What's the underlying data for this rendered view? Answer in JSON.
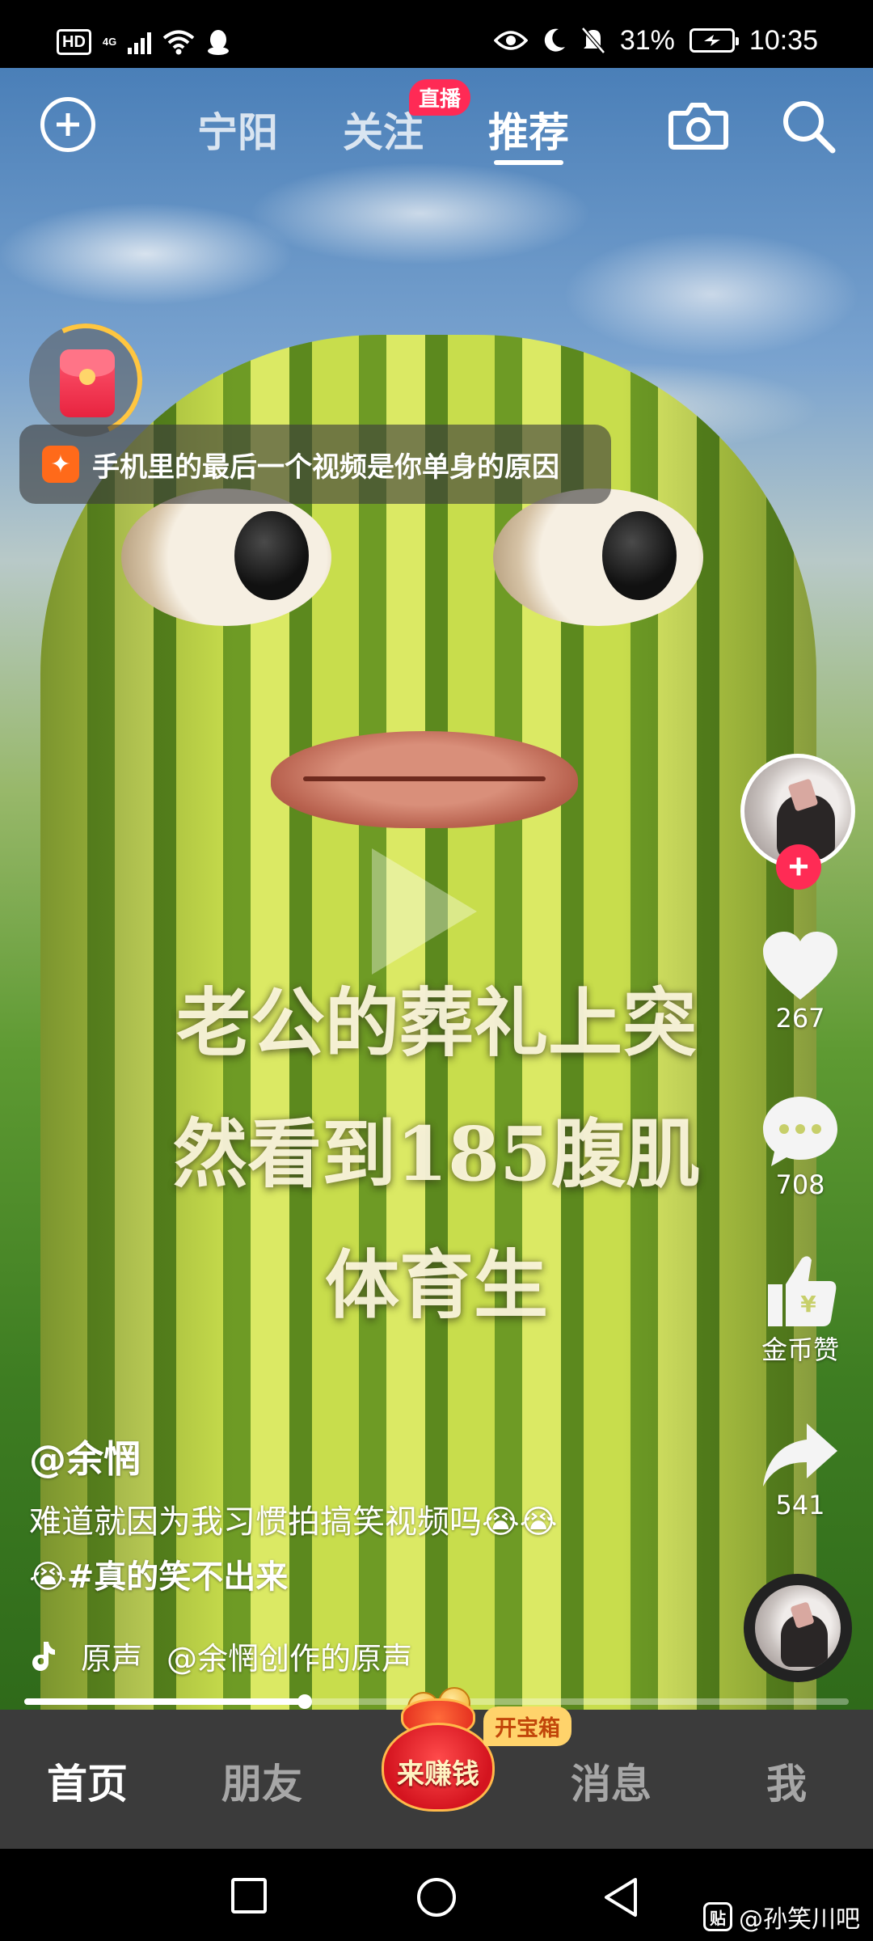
{
  "status_bar": {
    "left_icons": [
      "hd-icon",
      "4g-signal-icon",
      "wifi-icon",
      "qq-icon"
    ],
    "hd_label": "HD",
    "network_label": "4G",
    "right_icons": [
      "eye-comfort-icon",
      "moon-icon",
      "bell-muted-icon",
      "battery-charging-icon"
    ],
    "battery_percent": "31%",
    "time": "10:35"
  },
  "top_nav": {
    "add_icon": "plus-circle-icon",
    "tabs": [
      {
        "label": "宁阳",
        "active": false
      },
      {
        "label": "关注",
        "active": false,
        "badge": "直播"
      },
      {
        "label": "推荐",
        "active": true
      }
    ],
    "camera_icon": "camera-icon",
    "search_icon": "search-icon"
  },
  "promo": {
    "icon": "red-packet-icon",
    "badge_icon": "sparkle-icon",
    "text": "手机里的最后一个视频是你单身的原因"
  },
  "video": {
    "caption_lines": [
      "老公的葬礼上突",
      "然看到185腹肌",
      "体育生"
    ]
  },
  "actions": {
    "avatar_icon": "author-avatar",
    "follow_icon": "plus-icon",
    "like": {
      "icon": "heart-icon",
      "count": "267"
    },
    "comment": {
      "icon": "comment-icon",
      "count": "708"
    },
    "coin_like": {
      "icon": "coin-thumb-icon",
      "label": "金币赞"
    },
    "share": {
      "icon": "share-arrow-icon",
      "count": "541"
    },
    "music_disc_icon": "music-disc-avatar"
  },
  "post": {
    "author": "@余惘",
    "description_line1": "难道就因为我习惯拍搞笑视频吗😭😭",
    "description_line2_emoji": "😭",
    "hashtag": "#真的笑不出来",
    "music_icon": "tiktok-note-icon",
    "music_type": "原声",
    "music_title": "@余惘创作的原声",
    "progress": 0.34
  },
  "bottom_nav": {
    "items": [
      {
        "label": "首页",
        "active": true
      },
      {
        "label": "朋友",
        "active": false
      },
      {
        "label": "消息",
        "active": false
      },
      {
        "label": "我",
        "active": false
      }
    ],
    "earn_label": "来赚钱",
    "earn_icon": "money-bag-icon",
    "treasure_badge": "开宝箱"
  },
  "system_nav": {
    "recent_icon": "square-icon",
    "home_icon": "circle-icon",
    "back_icon": "back-triangle-icon"
  },
  "watermark": {
    "icon_text": "贴",
    "text": "@孙笑川吧"
  },
  "colors": {
    "accent_red": "#ff2b55",
    "bottom_nav_bg": "#3b3b3b",
    "treasure_bg": "#ffd36b"
  }
}
